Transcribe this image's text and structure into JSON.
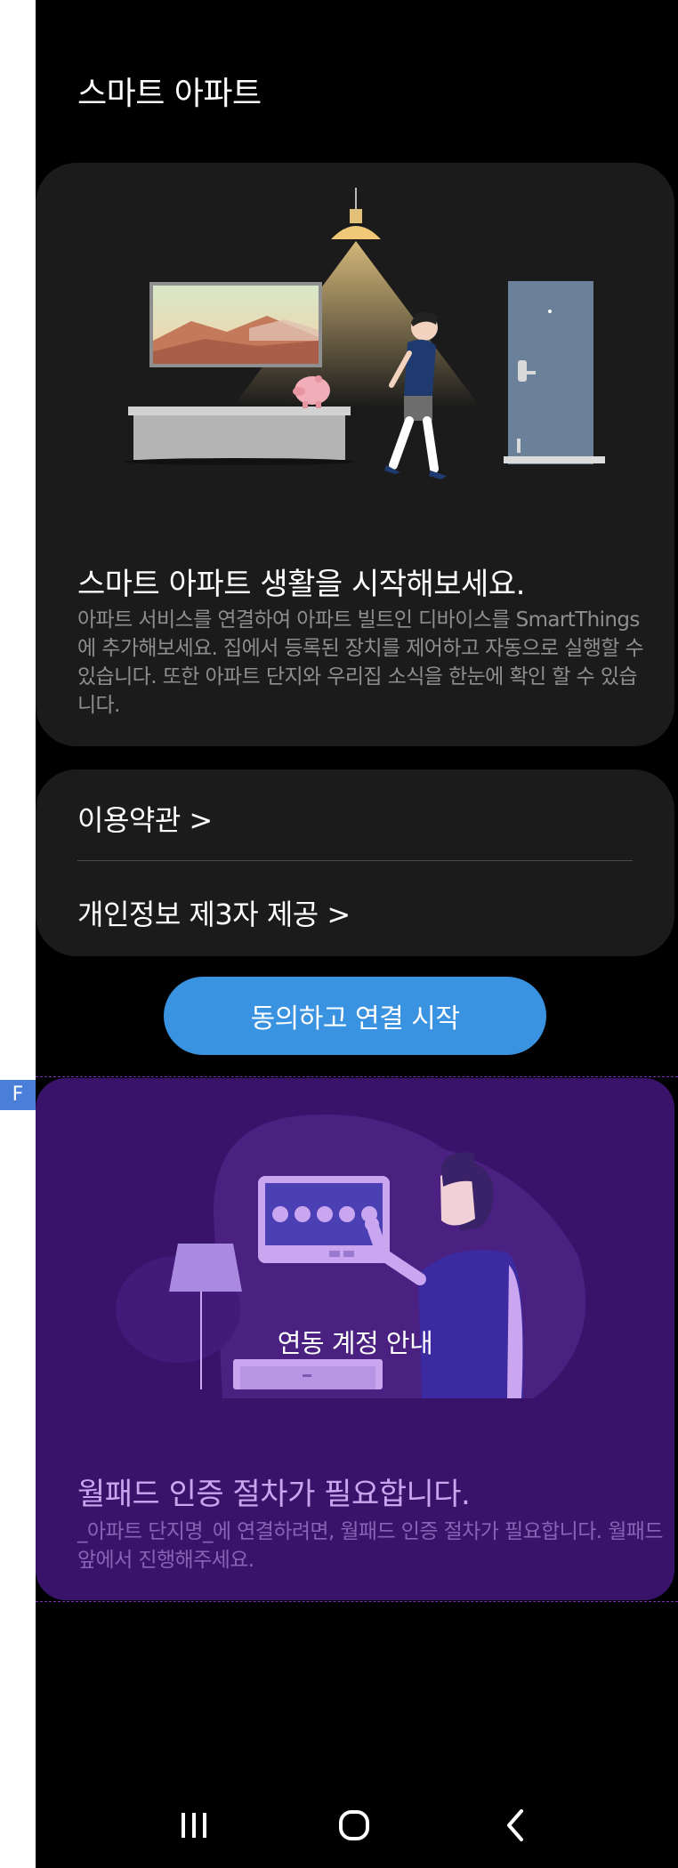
{
  "app": {
    "title": "스마트 아파트"
  },
  "intro": {
    "heading": "스마트 아파트 생활을 시작해보세요.",
    "body": "아파트 서비스를 연결하여 아파트 빌트인 디바이스를 SmartThings에 추가해보세요. 집에서 등록된 장치를 제어하고 자동으로 실행할 수 있습니다. 또한 아파트 단지와 우리집 소식을 한눈에 확인 할 수 있습니다."
  },
  "terms": {
    "terms_link": "이용약관 >",
    "privacy_link": "개인정보 제3자 제공 >"
  },
  "actions": {
    "agree_button": "동의하고 연결 시작"
  },
  "wallpad": {
    "illustration_caption": "연동 계정 안내",
    "heading": "월패드 인증 절차가 필요합니다.",
    "body": "_아파트 단지명_에 연결하려면, 월패드 인증 절차가 필요합니다. 월패드 앞에서 진행해주세요."
  },
  "overlay": {
    "marker": "F"
  },
  "nav": {
    "recents_icon": "recents-icon",
    "home_icon": "home-icon",
    "back_icon": "back-icon"
  },
  "colors": {
    "background": "#000000",
    "card": "#1b1b1b",
    "accent_button": "#3a93e1",
    "wallpad_card": "#39136a",
    "wallpad_heading": "#c9a6ef"
  }
}
